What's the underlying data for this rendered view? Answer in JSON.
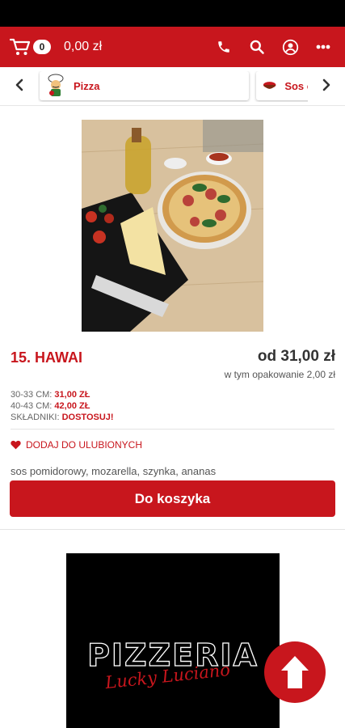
{
  "header": {
    "cart_count": "0",
    "cart_total": "0,00 zł",
    "icons": [
      "cart-icon",
      "phone-icon",
      "search-icon",
      "account-icon",
      "more-icon"
    ],
    "accent_color": "#c8161d"
  },
  "categories": {
    "items": [
      {
        "label": "Pizza",
        "icon": "pizza-chef-icon"
      },
      {
        "label": "Sos c",
        "icon": "sauce-bowl-icon"
      }
    ]
  },
  "product": {
    "name": "15. HAWAI",
    "price": "od 31,00 zł",
    "packaging": "w tym opakowanie 2,00 zł",
    "sizes": [
      {
        "label": "30-33 CM:",
        "price": "31,00 ZŁ"
      },
      {
        "label": "40-43 CM:",
        "price": "42,00 ZŁ"
      }
    ],
    "ingredients_label": "SKŁADNIKI:",
    "ingredients_action": "DOSTOSUJ!",
    "favorite_label": "DODAJ DO ULUBIONYCH",
    "description": "sos pomidorowy, mozarella, szynka, ananas",
    "add_to_cart": "Do koszyka"
  },
  "banner": {
    "title": "PIZZERIA",
    "subtitle": "Lucky Luciano"
  }
}
